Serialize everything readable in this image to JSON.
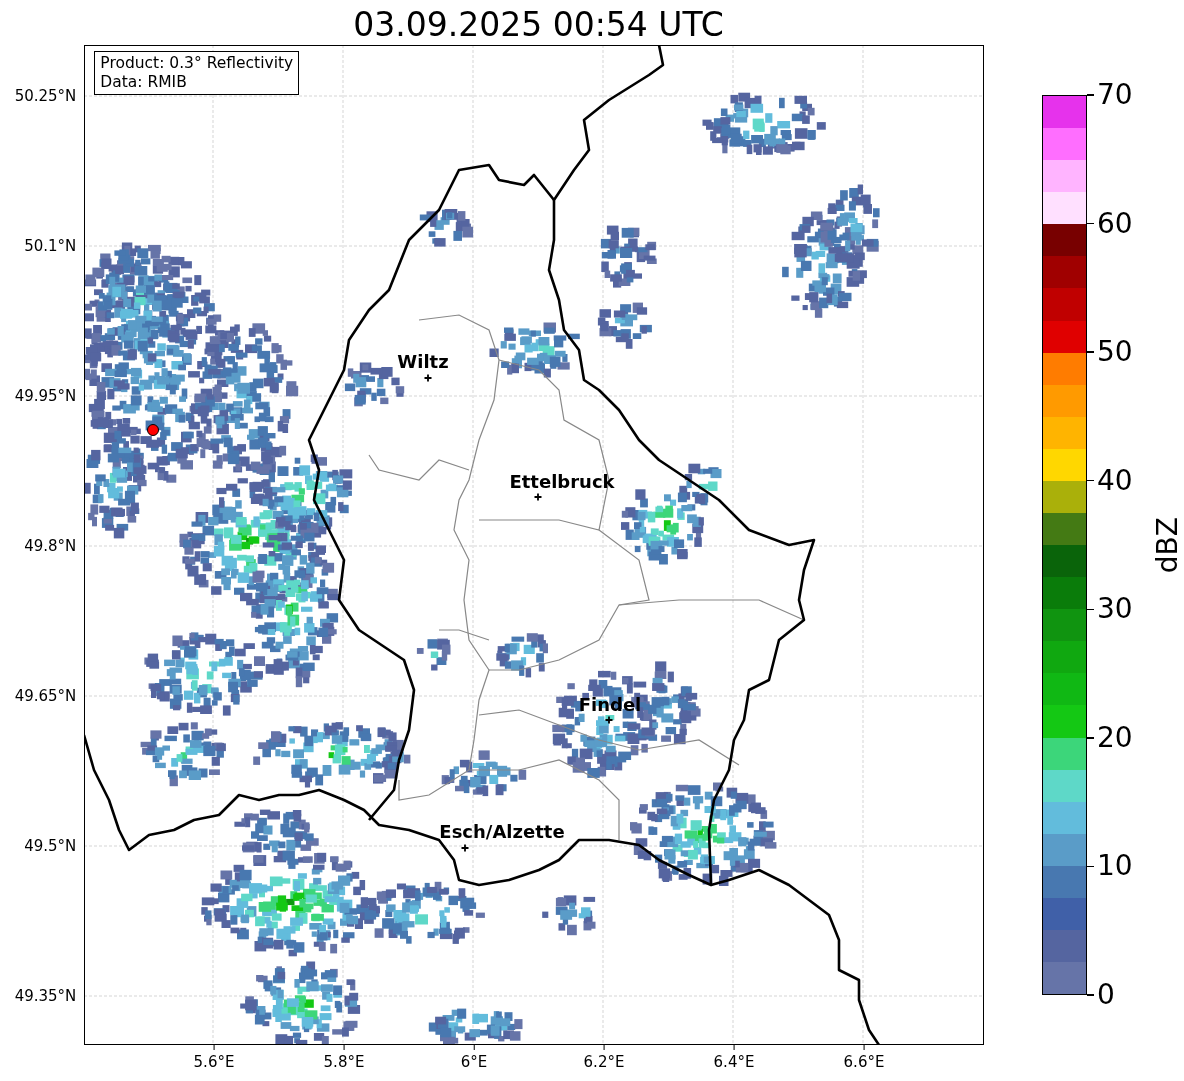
{
  "title": "03.09.2025 00:54 UTC",
  "info_box": [
    "Product: 0.3° Reflectivity",
    "Data: RMIB"
  ],
  "map": {
    "y_ticks": [
      "50.25°N",
      "50.1°N",
      "49.95°N",
      "49.8°N",
      "49.65°N",
      "49.5°N",
      "49.35°N"
    ],
    "x_ticks": [
      "5.6°E",
      "5.8°E",
      "6°E",
      "6.2°E",
      "6.4°E",
      "6.6°E"
    ],
    "cities": [
      {
        "name": "Wiltz"
      },
      {
        "name": "Ettelbruck"
      },
      {
        "name": "Findel"
      },
      {
        "name": "Esch/Alzette"
      }
    ]
  },
  "colorbar": {
    "label": "dBZ",
    "ticks": [
      "70",
      "60",
      "50",
      "40",
      "30",
      "20",
      "10",
      "0"
    ],
    "bins": [
      {
        "color": "#e632ec"
      },
      {
        "color": "#ff6eff"
      },
      {
        "color": "#ffb4ff"
      },
      {
        "color": "#ffe0ff"
      },
      {
        "color": "#780000"
      },
      {
        "color": "#a00000"
      },
      {
        "color": "#c00000"
      },
      {
        "color": "#e00000"
      },
      {
        "color": "#ff7c00"
      },
      {
        "color": "#ff9a00"
      },
      {
        "color": "#ffb400"
      },
      {
        "color": "#ffd700"
      },
      {
        "color": "#aab00a"
      },
      {
        "color": "#447a14"
      },
      {
        "color": "#0a640a"
      },
      {
        "color": "#0a7c0a"
      },
      {
        "color": "#109410"
      },
      {
        "color": "#10a810"
      },
      {
        "color": "#10b814"
      },
      {
        "color": "#14c814"
      },
      {
        "color": "#3cd67a"
      },
      {
        "color": "#5ed8c8"
      },
      {
        "color": "#62bcdc"
      },
      {
        "color": "#5a9cc8"
      },
      {
        "color": "#4878b0"
      },
      {
        "color": "#4060a8"
      },
      {
        "color": "#5565a0"
      },
      {
        "color": "#6674a8"
      }
    ]
  }
}
